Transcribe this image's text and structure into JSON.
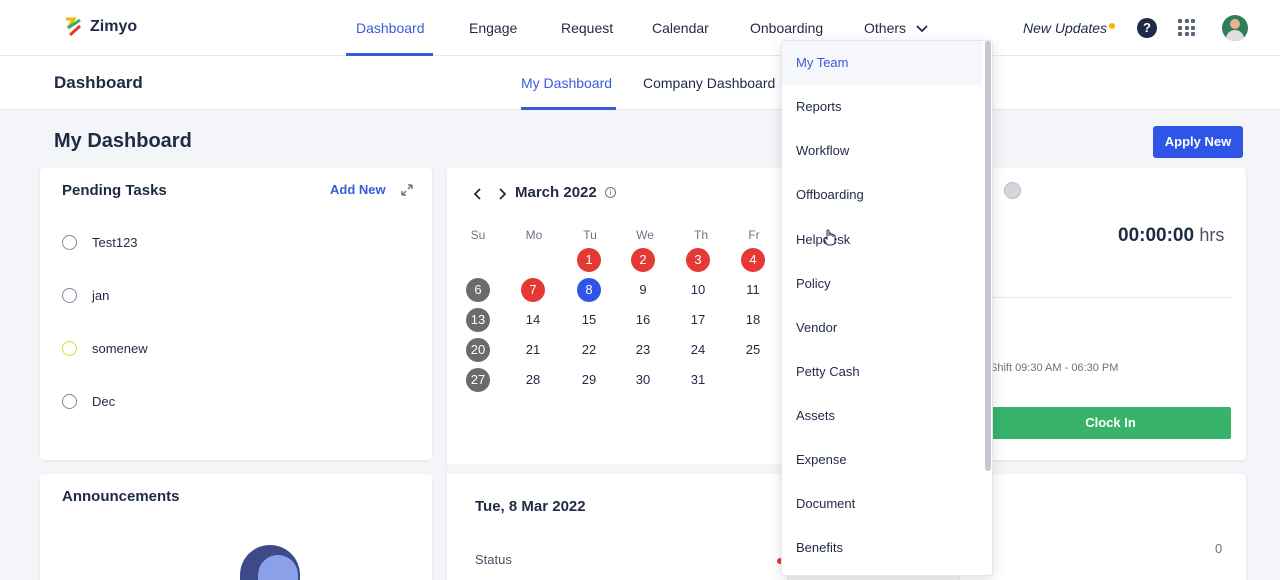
{
  "app": {
    "logo_text": "Zimyo"
  },
  "topnav": {
    "items": [
      "Dashboard",
      "Engage",
      "Request",
      "Calendar",
      "Onboarding",
      "Others"
    ],
    "new_updates": "New Updates",
    "help": "?"
  },
  "subheader": {
    "title": "Dashboard",
    "tabs": [
      "My Dashboard",
      "Company Dashboard"
    ]
  },
  "page": {
    "title": "My Dashboard",
    "apply_label": "Apply New"
  },
  "pending": {
    "title": "Pending Tasks",
    "add_new": "Add New",
    "tasks": [
      "Test123",
      "jan",
      "somenew",
      "Dec"
    ]
  },
  "announcements": {
    "title": "Announcements"
  },
  "calendar": {
    "month": "March 2022",
    "weekdays": [
      "Su",
      "Mo",
      "Tu",
      "We",
      "Th",
      "Fr"
    ],
    "rows": [
      [
        "",
        "",
        "1",
        "2",
        "3",
        "4"
      ],
      [
        "6",
        "7",
        "8",
        "9",
        "10",
        "11"
      ],
      [
        "13",
        "14",
        "15",
        "16",
        "17",
        "18"
      ],
      [
        "20",
        "21",
        "22",
        "23",
        "24",
        "25"
      ],
      [
        "27",
        "28",
        "29",
        "30",
        "31",
        ""
      ]
    ],
    "selected_date": "Tue, 8 Mar 2022",
    "status_label": "Status"
  },
  "attendance": {
    "timer": "00:00:00",
    "unit": "hrs",
    "shift": "Shift 09:30 AM - 06:30 PM",
    "clock_in": "Clock In",
    "count": "0"
  },
  "dropdown": {
    "items": [
      "My Team",
      "Reports",
      "Workflow",
      "Offboarding",
      "Helpdesk",
      "Policy",
      "Vendor",
      "Petty Cash",
      "Assets",
      "Expense",
      "Document",
      "Benefits"
    ]
  },
  "colors": {
    "accent": "#3a5bd9",
    "apply_button": "#2f55e8",
    "clock_in": "#38b36a",
    "holiday_red": "#e53935",
    "weekend_grey": "#6b6b6b",
    "today_blue": "#2f55e8"
  }
}
